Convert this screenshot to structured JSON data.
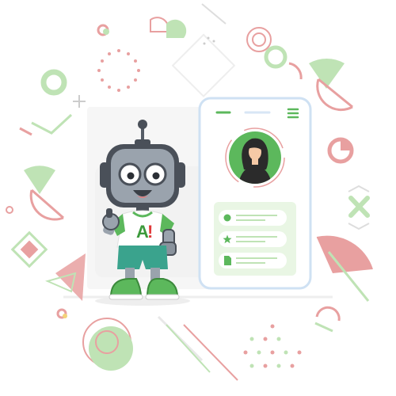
{
  "illustration": {
    "robot": {
      "shirt_mark": "A",
      "shirt_mark_accent": "!"
    }
  },
  "phone": {
    "profile_items": [
      {
        "icon": "dot-icon"
      },
      {
        "icon": "star-icon"
      },
      {
        "icon": "document-icon"
      }
    ]
  },
  "colors": {
    "green": "#5cb85c",
    "green_light": "#bfe3b5",
    "pink": "#e8a0a0",
    "pink_dark": "#d9707a",
    "gray_light": "#eeeeee",
    "phone_border": "#cfe1f3",
    "shirt_mark_red": "#e03a3a"
  }
}
